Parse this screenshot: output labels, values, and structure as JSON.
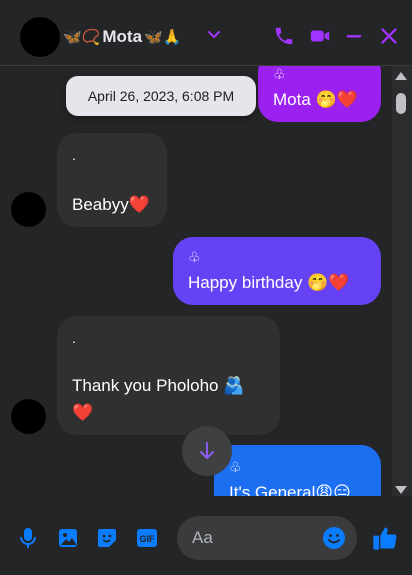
{
  "header": {
    "name": "Mota",
    "prefix_emoji": "🦋📿",
    "suffix_emoji": "🦋🙏",
    "accent": "#a033ff"
  },
  "tooltip": {
    "text": "April 26, 2023, 6:08 PM"
  },
  "messages": [
    {
      "sender": "me",
      "tag": "♧",
      "text": "Mota 🤭❤️",
      "color": "#9b21f0"
    },
    {
      "sender": "them",
      "tag": ".",
      "text": "Beabyy❤️"
    },
    {
      "sender": "me",
      "tag": "♧",
      "text": "Happy birthday 🤭❤️",
      "color": "#6543f5"
    },
    {
      "sender": "them",
      "tag": ".",
      "text": "Thank you Pholoho 🫂",
      "text2": "❤️"
    },
    {
      "sender": "me",
      "tag": "♧",
      "text": "It's General😩😑",
      "color": "#1d6ff2"
    }
  ],
  "composer": {
    "placeholder": "Aa",
    "accent": "#0a7cff"
  }
}
